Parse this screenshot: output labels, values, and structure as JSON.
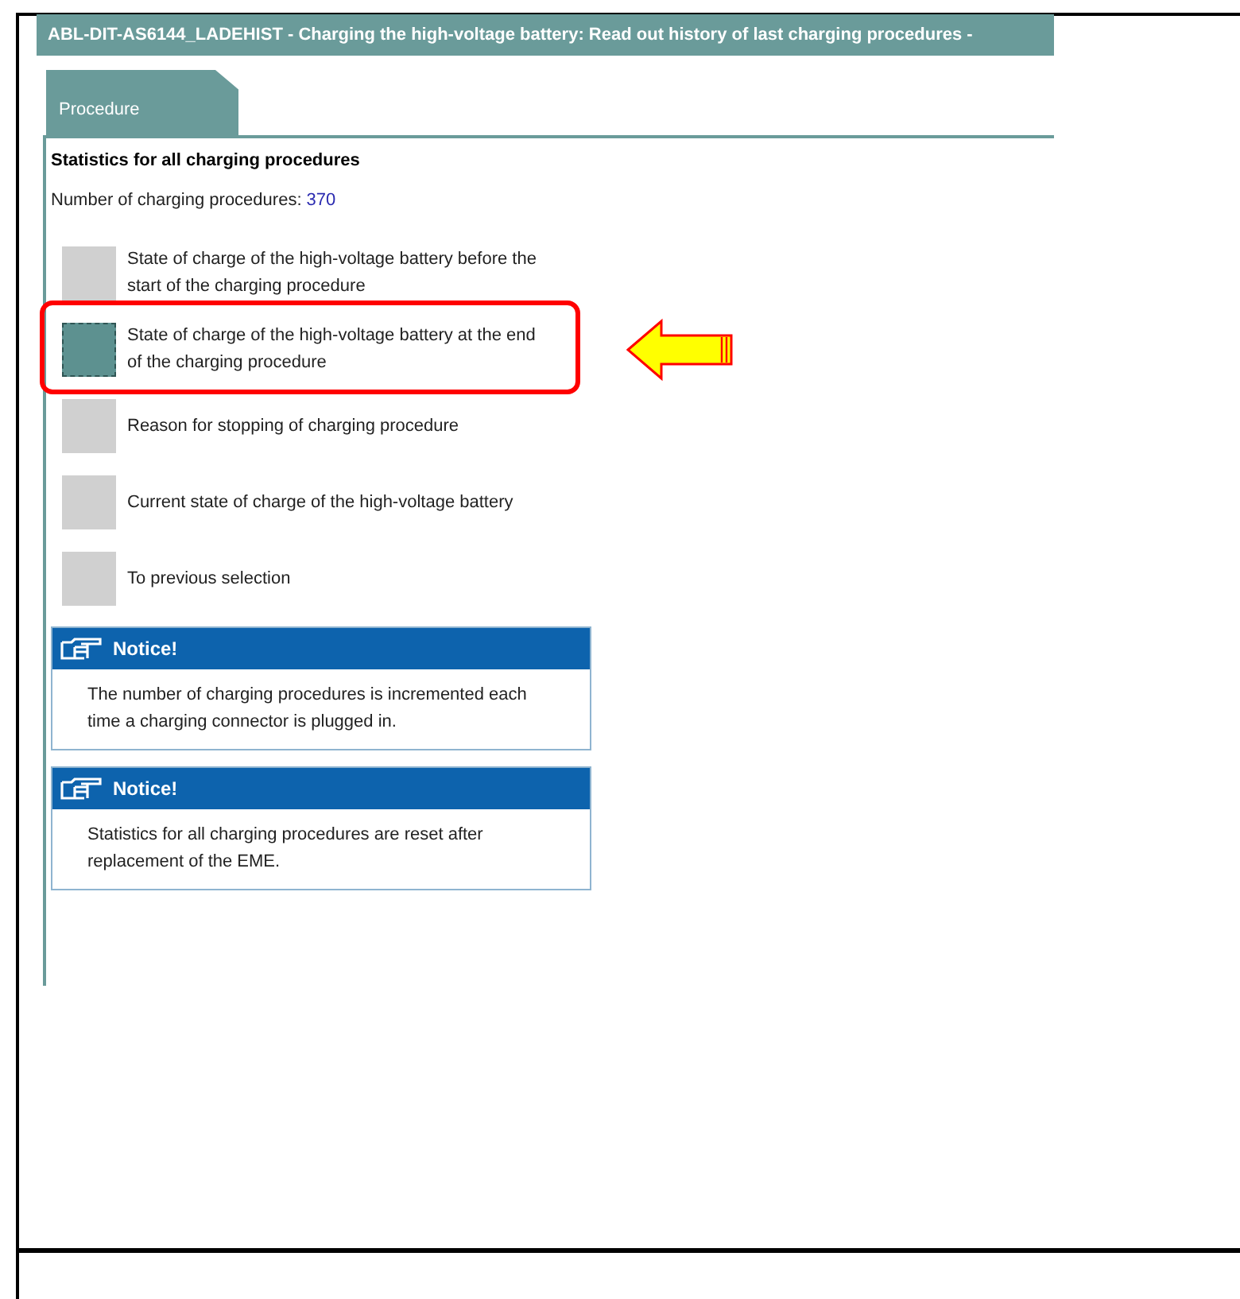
{
  "window": {
    "title": "ABL-DIT-AS6144_LADEHIST - Charging the high-voltage battery: Read out history of last charging procedures -"
  },
  "tabs": [
    {
      "label": "Procedure",
      "selected": true
    }
  ],
  "content": {
    "heading": "Statistics for all charging procedures",
    "count_label": "Number of charging procedures:",
    "count_value": "370",
    "options": [
      {
        "label": "State of charge of the high-voltage battery before the start of the charging procedure",
        "selected": false,
        "highlighted": false
      },
      {
        "label": "State of charge of the high-voltage battery at the end of the charging procedure",
        "selected": true,
        "highlighted": true
      },
      {
        "label": "Reason for stopping of charging procedure",
        "selected": false,
        "highlighted": false
      },
      {
        "label": "Current state of charge of the high-voltage battery",
        "selected": false,
        "highlighted": false
      },
      {
        "label": "To previous selection",
        "selected": false,
        "highlighted": false
      }
    ],
    "notices": [
      {
        "title": "Notice!",
        "text": "The number of charging procedures is incremented each time a charging connector is plugged in."
      },
      {
        "title": "Notice!",
        "text": "Statistics for all charging procedures are reset after replacement of the EME."
      }
    ]
  }
}
